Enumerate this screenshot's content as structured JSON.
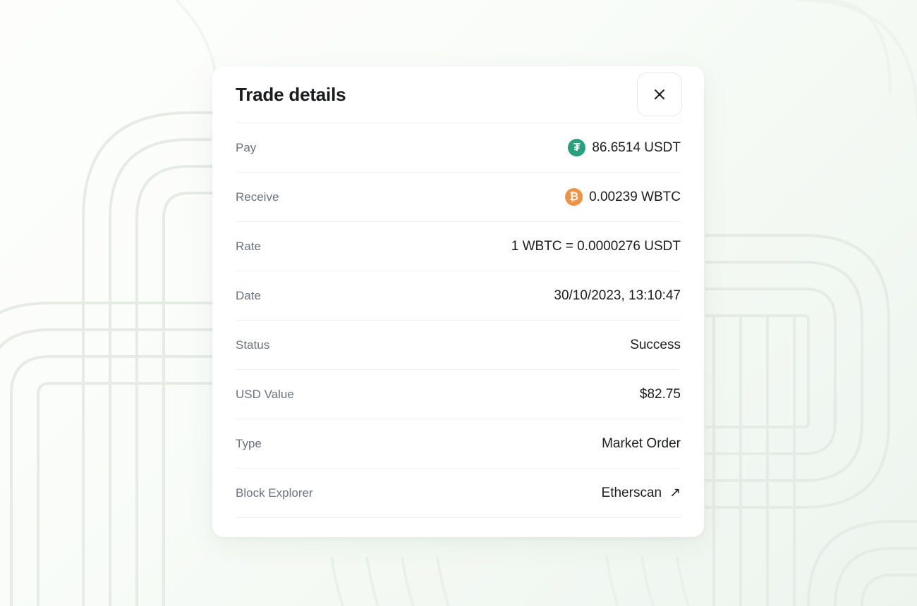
{
  "background": {
    "style_name": "decorative-arc-lines",
    "base_color_top_left": "#fdfefc",
    "base_color_bottom_right": "#edf4ee",
    "line_color": "#e7ece7"
  },
  "modal": {
    "title": "Trade details",
    "close_icon": "close-icon",
    "close_label": "Close",
    "rows": [
      {
        "label": "Pay",
        "value": "86.6514 USDT",
        "icon": "usdt-token-icon",
        "icon_glyph": "₮",
        "icon_color": "#26a17b"
      },
      {
        "label": "Receive",
        "value": "0.00239 WBTC",
        "icon": "wbtc-token-icon",
        "icon_glyph": "₿",
        "icon_color": "#f09242"
      },
      {
        "label": "Rate",
        "value": "1 WBTC = 0.0000276 USDT"
      },
      {
        "label": "Date",
        "value": "30/10/2023, 13:10:47"
      },
      {
        "label": "Status",
        "value": "Success"
      },
      {
        "label": "USD Value",
        "value": "$82.75"
      },
      {
        "label": "Type",
        "value": "Market Order"
      },
      {
        "label": "Block Explorer",
        "value": "Etherscan",
        "link_icon": "external-link-arrow-icon",
        "link_glyph": "↗"
      }
    ]
  }
}
